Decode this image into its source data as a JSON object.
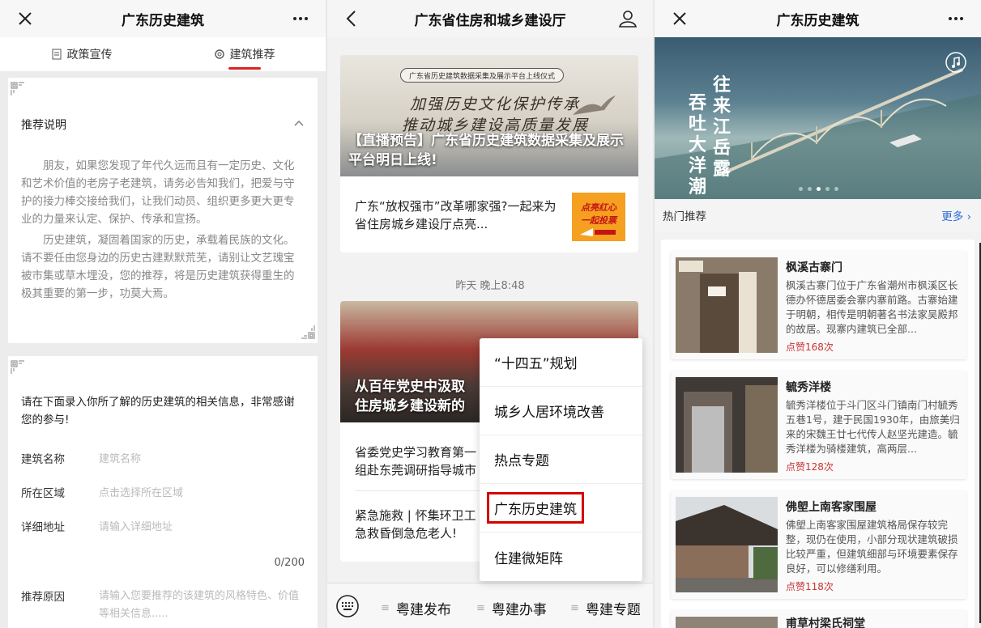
{
  "panel1": {
    "title": "广东历史建筑",
    "tabs": [
      {
        "label": "政策宣传",
        "icon": "document-icon"
      },
      {
        "label": "建筑推荐",
        "icon": "gear-icon"
      }
    ],
    "card1": {
      "heading": "推荐说明",
      "para1": "朋友，如果您发现了年代久远而且有一定历史、文化和艺术价值的老房子老建筑，请务必告知我们，把爱与守护的接力棒交接给我们，让我们动员、组织更多更大更专业的力量来认定、保护、传承和宣扬。",
      "para2": "历史建筑，凝固着国家的历史，承载着民族的文化。请不要任由您身边的历史古建默默荒芜，请别让文艺瑰宝被市集或草木埋没，您的推荐，将是历史建筑获得重生的极其重要的第一步，功莫大焉。"
    },
    "card2": {
      "intro": "请在下面录入你所了解的历史建筑的相关信息，非常感谢您的参与!",
      "fields": [
        {
          "label": "建筑名称",
          "placeholder": "建筑名称"
        },
        {
          "label": "所在区域",
          "placeholder": "点击选择所在区域"
        },
        {
          "label": "详细地址",
          "placeholder": "请输入详细地址"
        }
      ],
      "counter": "0/200",
      "reason_label": "推荐原因",
      "reason_placeholder": "请输入您要推荐的该建筑的风格特色、价值等相关信息....."
    }
  },
  "panel2": {
    "title": "广东省住房和城乡建设厅",
    "card1": {
      "ribbon": "广东省历史建筑数据采集及展示平台上线仪式",
      "callig1": "加强历史文化保护传承",
      "callig2": "推动城乡建设高质量发展",
      "overlay": "【直播预告】广东省历史建筑数据采集及展示平台明日上线!",
      "sub_article": "广东“放权强市”改革哪家强?一起来为省住房城乡建设厅点亮...",
      "thumb_line1": "点亮红心",
      "thumb_line2": "一起投票"
    },
    "timestamp": "昨天 晚上8:48",
    "card2": {
      "overlay1": "从百年党史中汲取",
      "overlay2": "住房城乡建设新的",
      "item1_line1": "省委党史学习教育第一",
      "item1_line2": "组赴东莞调研指导城市",
      "item2_line1": "紧急施救 | 怀集环卫工",
      "item2_line2": "急救昏倒急危老人!"
    },
    "menu": [
      "“十四五”规划",
      "城乡人居环境改善",
      "热点专题",
      "广东历史建筑",
      "住建微矩阵"
    ],
    "menu_highlight_index": 3,
    "bottom_buttons": [
      "粤建发布",
      "粤建办事",
      "粤建专题"
    ]
  },
  "panel3": {
    "title": "广东历史建筑",
    "hero_col1": "吞吐大洋潮",
    "hero_col2": "往来江岳露",
    "hot_label": "热门推荐",
    "more_label": "更多",
    "items": [
      {
        "title": "枫溪古寨门",
        "desc": "枫溪古寨门位于广东省潮州市枫溪区长德办怀德居委会寨内寨前路。古寨始建于明朝，相传是明朝著名书法家吴殿邦的故居。现寨内建筑已全部...",
        "likes": "点赞168次"
      },
      {
        "title": "毓秀洋楼",
        "desc": "毓秀洋楼位于斗门区斗门镇南门村毓秀五巷1号，建于民国1930年，由旅美归来的宋魏王廿七代传人赵坚光建造。毓秀洋楼为骑楼建筑，高两层...",
        "likes": "点赞128次"
      },
      {
        "title": "佛塱上南客家围屋",
        "desc": "佛塱上南客家围屋建筑格局保存较完整，现仍在使用，小部分现状建筑破损比较严重，但建筑细部与环境要素保存良好，可以修缮利用。",
        "likes": "点赞118次"
      },
      {
        "title": "甫草村梁氏祠堂"
      }
    ]
  },
  "colors": {
    "accent_red": "#d22222",
    "link_blue": "#2a6ed8"
  }
}
